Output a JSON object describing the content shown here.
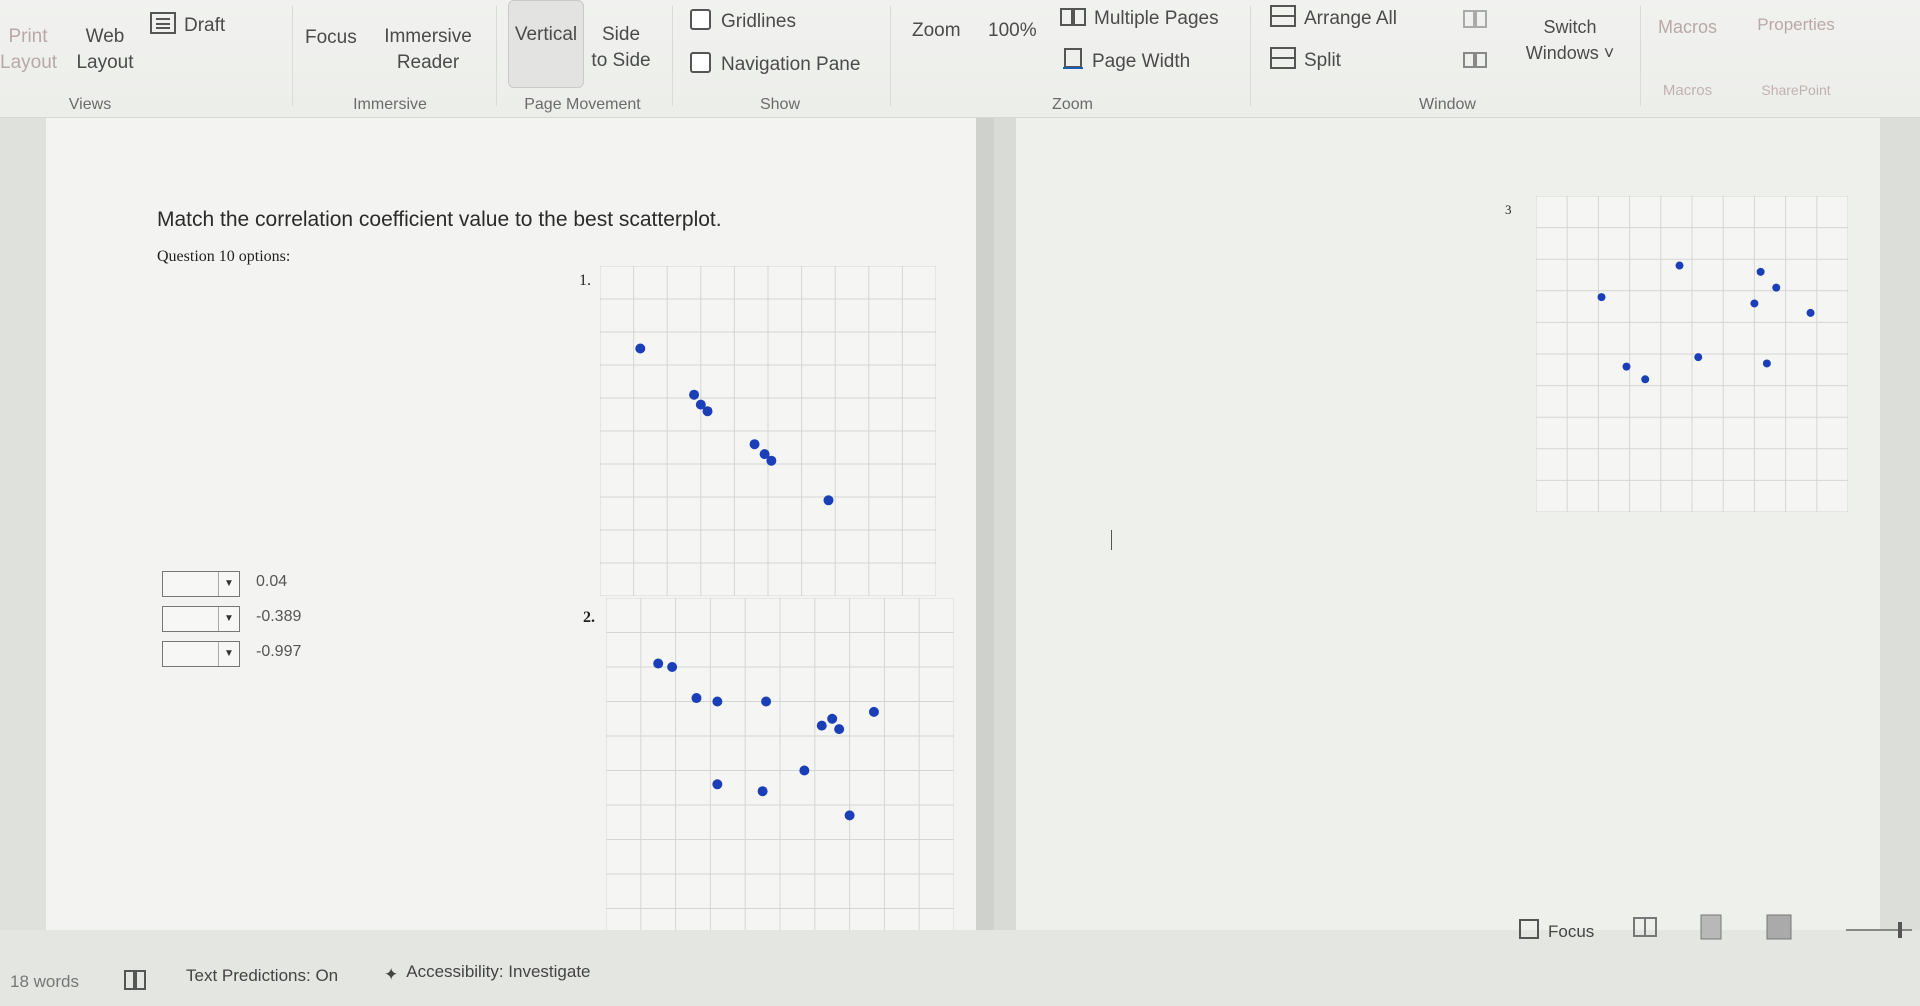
{
  "ribbon": {
    "views": {
      "print_layout": "Print\nLayout",
      "web_layout": "Web\nLayout",
      "draft": "Draft",
      "label": "Views"
    },
    "immersive": {
      "focus": "Focus",
      "reader": "Immersive\nReader",
      "label": "Immersive"
    },
    "page_movement": {
      "vertical": "Vertical",
      "side_to_side": "Side\nto Side",
      "label": "Page Movement"
    },
    "show": {
      "gridlines": "Gridlines",
      "navigation_pane": "Navigation Pane",
      "label": "Show"
    },
    "zoom": {
      "zoom": "Zoom",
      "hundred": "100%",
      "multiple_pages": "Multiple Pages",
      "page_width": "Page Width",
      "label": "Zoom"
    },
    "window": {
      "arrange_all": "Arrange All",
      "split": "Split",
      "switch_windows": "Switch\nWindows ˅",
      "label": "Window"
    },
    "macros": {
      "macros": "Macros",
      "label": "Macros"
    },
    "sharepoint": {
      "properties": "Properties",
      "label": "SharePoint"
    }
  },
  "document": {
    "title": "Match the correlation coefficient value to the best scatterplot.",
    "subtitle": "Question 10 options:",
    "options": [
      {
        "value": "0.04"
      },
      {
        "value": "-0.389"
      },
      {
        "value": "-0.997"
      }
    ],
    "plots": [
      {
        "label": "1.",
        "points": [
          [
            1.2,
            7.5
          ],
          [
            2.8,
            6.1
          ],
          [
            3.0,
            5.8
          ],
          [
            3.2,
            5.6
          ],
          [
            4.6,
            4.6
          ],
          [
            4.9,
            4.3
          ],
          [
            5.1,
            4.1
          ],
          [
            6.8,
            2.9
          ]
        ]
      },
      {
        "label": "2.",
        "points": [
          [
            1.5,
            8.1
          ],
          [
            1.9,
            8.0
          ],
          [
            2.6,
            7.1
          ],
          [
            3.2,
            7.0
          ],
          [
            3.2,
            4.6
          ],
          [
            4.5,
            4.4
          ],
          [
            4.6,
            7.0
          ],
          [
            5.7,
            5.0
          ],
          [
            6.2,
            6.3
          ],
          [
            6.5,
            6.5
          ],
          [
            6.7,
            6.2
          ],
          [
            7.7,
            6.7
          ],
          [
            7.0,
            3.7
          ]
        ]
      },
      {
        "label": "3",
        "points": [
          [
            2.1,
            6.8
          ],
          [
            2.9,
            4.6
          ],
          [
            3.5,
            4.2
          ],
          [
            4.6,
            7.8
          ],
          [
            5.2,
            4.9
          ],
          [
            7.0,
            6.6
          ],
          [
            7.2,
            7.6
          ],
          [
            7.4,
            4.7
          ],
          [
            7.7,
            7.1
          ],
          [
            8.8,
            6.3
          ]
        ]
      }
    ]
  },
  "status": {
    "words": "18 words",
    "predictions": "Text Predictions: On",
    "accessibility": "Accessibility: Investigate",
    "focus": "Focus"
  },
  "colors": {
    "point": "#1a3fb8",
    "grid": "#d3d6d3"
  }
}
